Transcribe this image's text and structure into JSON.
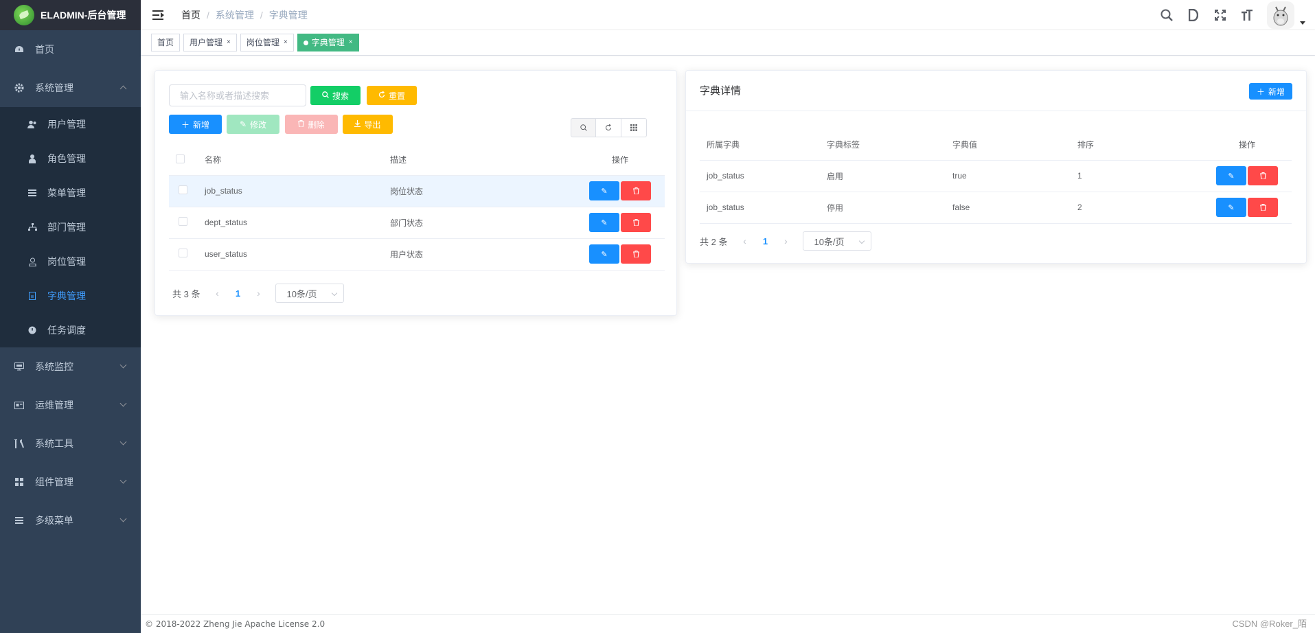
{
  "app": {
    "title": "ELADMIN-后台管理"
  },
  "sidebar": {
    "items": [
      {
        "label": "首页",
        "icon": "dashboard-icon"
      },
      {
        "label": "系统管理",
        "icon": "gear-icon",
        "expanded": true,
        "children": [
          {
            "label": "用户管理",
            "icon": "users-icon"
          },
          {
            "label": "角色管理",
            "icon": "role-icon"
          },
          {
            "label": "菜单管理",
            "icon": "menu-icon"
          },
          {
            "label": "部门管理",
            "icon": "tree-icon"
          },
          {
            "label": "岗位管理",
            "icon": "post-icon"
          },
          {
            "label": "字典管理",
            "icon": "dictionary-icon",
            "active": true
          },
          {
            "label": "任务调度",
            "icon": "clock-icon"
          }
        ]
      },
      {
        "label": "系统监控",
        "icon": "monitor-icon"
      },
      {
        "label": "运维管理",
        "icon": "ops-icon"
      },
      {
        "label": "系统工具",
        "icon": "tools-icon"
      },
      {
        "label": "组件管理",
        "icon": "components-icon"
      },
      {
        "label": "多级菜单",
        "icon": "list-icon"
      }
    ]
  },
  "breadcrumb": [
    "首页",
    "系统管理",
    "字典管理"
  ],
  "tags": [
    {
      "label": "首页"
    },
    {
      "label": "用户管理"
    },
    {
      "label": "岗位管理"
    },
    {
      "label": "字典管理",
      "active": true
    }
  ],
  "left": {
    "search_placeholder": "输入名称或者描述搜索",
    "search_label": "搜索",
    "reset_label": "重置",
    "add_label": "新增",
    "edit_label": "修改",
    "delete_label": "删除",
    "export_label": "导出",
    "columns": {
      "name": "名称",
      "desc": "描述",
      "op": "操作"
    },
    "rows": [
      {
        "name": "job_status",
        "desc": "岗位状态"
      },
      {
        "name": "dept_status",
        "desc": "部门状态"
      },
      {
        "name": "user_status",
        "desc": "用户状态"
      }
    ],
    "pager": {
      "total": "共 3 条",
      "page": "1",
      "size": "10条/页"
    }
  },
  "right": {
    "title": "字典详情",
    "add_label": "新增",
    "columns": {
      "dict": "所属字典",
      "label": "字典标签",
      "value": "字典值",
      "sort": "排序",
      "op": "操作"
    },
    "rows": [
      {
        "dict": "job_status",
        "label": "启用",
        "value": "true",
        "sort": "1"
      },
      {
        "dict": "job_status",
        "label": "停用",
        "value": "false",
        "sort": "2"
      }
    ],
    "pager": {
      "total": "共 2 条",
      "page": "1",
      "size": "10条/页"
    }
  },
  "footer": {
    "text": "© 2018-2022 Zheng Jie Apache License 2.0"
  },
  "watermark": "CSDN @Roker_陌",
  "colors": {
    "sidebar": "#304156",
    "submenu": "#1f2d3d",
    "active": "#409eff",
    "tag_active": "#42b983",
    "primary": "#1890ff",
    "success": "#13ce66",
    "warning": "#ffba00",
    "danger": "#ff4949"
  }
}
